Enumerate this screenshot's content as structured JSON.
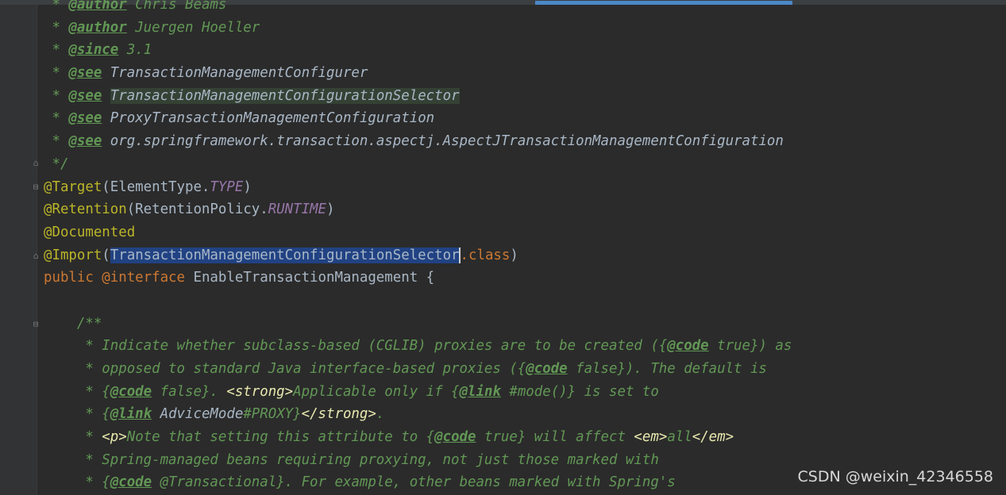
{
  "editor": {
    "lines": [
      {
        "segments": [
          {
            "t": " * ",
            "c": "cmt"
          },
          {
            "t": "@author",
            "c": "tag"
          },
          {
            "t": " Chris Beams",
            "c": "cmt"
          }
        ]
      },
      {
        "segments": [
          {
            "t": " * ",
            "c": "cmt"
          },
          {
            "t": "@author",
            "c": "tag"
          },
          {
            "t": " Juergen Hoeller",
            "c": "cmt"
          }
        ]
      },
      {
        "segments": [
          {
            "t": " * ",
            "c": "cmt"
          },
          {
            "t": "@since",
            "c": "tag"
          },
          {
            "t": " 3.1",
            "c": "cmt"
          }
        ]
      },
      {
        "segments": [
          {
            "t": " * ",
            "c": "cmt"
          },
          {
            "t": "@see",
            "c": "tag"
          },
          {
            "t": " ",
            "c": "cmt"
          },
          {
            "t": "TransactionManagementConfigurer",
            "c": "ref"
          }
        ]
      },
      {
        "segments": [
          {
            "t": " * ",
            "c": "cmt"
          },
          {
            "t": "@see",
            "c": "tag"
          },
          {
            "t": " ",
            "c": "cmt"
          },
          {
            "t": "TransactionManagementConfigurationSelector",
            "c": "ref hl"
          }
        ]
      },
      {
        "segments": [
          {
            "t": " * ",
            "c": "cmt"
          },
          {
            "t": "@see",
            "c": "tag"
          },
          {
            "t": " ",
            "c": "cmt"
          },
          {
            "t": "ProxyTransactionManagementConfiguration",
            "c": "ref"
          }
        ]
      },
      {
        "segments": [
          {
            "t": " * ",
            "c": "cmt"
          },
          {
            "t": "@see",
            "c": "tag"
          },
          {
            "t": " ",
            "c": "cmt"
          },
          {
            "t": "org.springframework.transaction.aspectj.AspectJTransactionManagementConfiguration",
            "c": "ref"
          }
        ]
      },
      {
        "segments": [
          {
            "t": " */",
            "c": "cmt"
          }
        ]
      },
      {
        "segments": [
          {
            "t": "@Target",
            "c": "ann"
          },
          {
            "t": "(ElementType.",
            "c": "plain"
          },
          {
            "t": "TYPE",
            "c": "const"
          },
          {
            "t": ")",
            "c": "plain"
          }
        ]
      },
      {
        "segments": [
          {
            "t": "@Retention",
            "c": "ann"
          },
          {
            "t": "(RetentionPolicy.",
            "c": "plain"
          },
          {
            "t": "RUNTIME",
            "c": "const"
          },
          {
            "t": ")",
            "c": "plain"
          }
        ]
      },
      {
        "segments": [
          {
            "t": "@Documented",
            "c": "ann"
          }
        ]
      },
      {
        "segments": [
          {
            "t": "@Import",
            "c": "ann"
          },
          {
            "t": "(",
            "c": "plain"
          },
          {
            "t": "TransactionManagementConfigurationSelector",
            "c": "plain sel"
          },
          {
            "t": "",
            "c": "caret"
          },
          {
            "t": ".class",
            "c": "kw"
          },
          {
            "t": ")",
            "c": "plain"
          }
        ]
      },
      {
        "segments": [
          {
            "t": "public ",
            "c": "kw"
          },
          {
            "t": "@interface",
            "c": "kw"
          },
          {
            "t": " EnableTransactionManagement {",
            "c": "plain"
          }
        ]
      },
      {
        "segments": [
          {
            "t": "",
            "c": "plain"
          }
        ]
      },
      {
        "segments": [
          {
            "t": "    /**",
            "c": "cmt"
          }
        ]
      },
      {
        "segments": [
          {
            "t": "     * Indicate whether subclass-based (CGLIB) proxies are to be created ({",
            "c": "cmt"
          },
          {
            "t": "@code",
            "c": "tag"
          },
          {
            "t": " true}) as",
            "c": "cmt"
          }
        ]
      },
      {
        "segments": [
          {
            "t": "     * opposed to standard Java interface-based proxies ({",
            "c": "cmt"
          },
          {
            "t": "@code",
            "c": "tag"
          },
          {
            "t": " false}). The default is",
            "c": "cmt"
          }
        ]
      },
      {
        "segments": [
          {
            "t": "     * {",
            "c": "cmt"
          },
          {
            "t": "@code",
            "c": "tag"
          },
          {
            "t": " false}. ",
            "c": "cmt"
          },
          {
            "t": "<strong>",
            "c": "htag"
          },
          {
            "t": "Applicable only if {",
            "c": "cmt"
          },
          {
            "t": "@link",
            "c": "tag"
          },
          {
            "t": " #mode()} is set to",
            "c": "cmt"
          }
        ]
      },
      {
        "segments": [
          {
            "t": "     * {",
            "c": "cmt"
          },
          {
            "t": "@link",
            "c": "tag"
          },
          {
            "t": " ",
            "c": "cmt"
          },
          {
            "t": "AdviceMode",
            "c": "ref"
          },
          {
            "t": "#PROXY}",
            "c": "cmt"
          },
          {
            "t": "</strong>",
            "c": "htag"
          },
          {
            "t": ".",
            "c": "cmt"
          }
        ]
      },
      {
        "segments": [
          {
            "t": "     * ",
            "c": "cmt"
          },
          {
            "t": "<p>",
            "c": "htag"
          },
          {
            "t": "Note that setting this attribute to {",
            "c": "cmt"
          },
          {
            "t": "@code",
            "c": "tag"
          },
          {
            "t": " true} will affect ",
            "c": "cmt"
          },
          {
            "t": "<em>",
            "c": "htag"
          },
          {
            "t": "all",
            "c": "cmt"
          },
          {
            "t": "</em>",
            "c": "htag"
          }
        ]
      },
      {
        "segments": [
          {
            "t": "     * Spring-managed beans requiring proxying, not just those marked with",
            "c": "cmt"
          }
        ]
      },
      {
        "segments": [
          {
            "t": "     * {",
            "c": "cmt"
          },
          {
            "t": "@code",
            "c": "tag"
          },
          {
            "t": " @Transactional}. For example, other beans marked with Spring's",
            "c": "cmt"
          }
        ]
      }
    ]
  },
  "watermark": "CSDN @weixin_42346558"
}
